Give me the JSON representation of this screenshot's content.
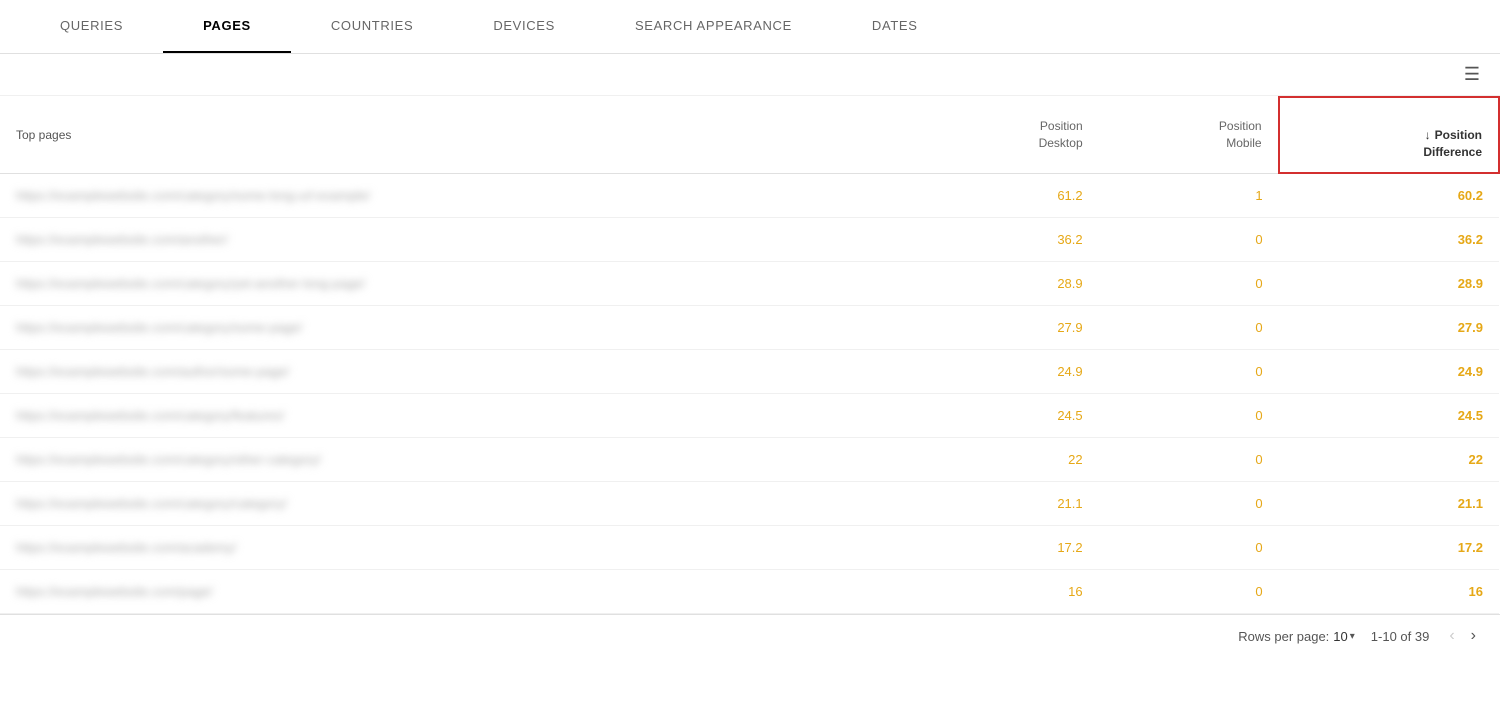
{
  "tabs": [
    {
      "id": "queries",
      "label": "QUERIES",
      "active": false
    },
    {
      "id": "pages",
      "label": "PAGES",
      "active": true
    },
    {
      "id": "countries",
      "label": "COUNTRIES",
      "active": false
    },
    {
      "id": "devices",
      "label": "DEVICES",
      "active": false
    },
    {
      "id": "search-appearance",
      "label": "SEARCH APPEARANCE",
      "active": false
    },
    {
      "id": "dates",
      "label": "DATES",
      "active": false
    }
  ],
  "table": {
    "col_pages_label": "Top pages",
    "col_desktop_label": "Position\nDesktop",
    "col_mobile_label": "Position\nMobile",
    "col_diff_label": "Position\nDifference",
    "rows": [
      {
        "page": "https://examplewebsite.com/category/some-long-url-example/",
        "desktop": "61.2",
        "mobile": "1",
        "diff": "60.2"
      },
      {
        "page": "https://examplewebsite.com/another/",
        "desktop": "36.2",
        "mobile": "0",
        "diff": "36.2"
      },
      {
        "page": "https://examplewebsite.com/category/yet-another-long-page/",
        "desktop": "28.9",
        "mobile": "0",
        "diff": "28.9"
      },
      {
        "page": "https://examplewebsite.com/category/some-page/",
        "desktop": "27.9",
        "mobile": "0",
        "diff": "27.9"
      },
      {
        "page": "https://examplewebsite.com/author/some-page/",
        "desktop": "24.9",
        "mobile": "0",
        "diff": "24.9"
      },
      {
        "page": "https://examplewebsite.com/category/features/",
        "desktop": "24.5",
        "mobile": "0",
        "diff": "24.5"
      },
      {
        "page": "https://examplewebsite.com/category/other-category/",
        "desktop": "22",
        "mobile": "0",
        "diff": "22"
      },
      {
        "page": "https://examplewebsite.com/category/category/",
        "desktop": "21.1",
        "mobile": "0",
        "diff": "21.1"
      },
      {
        "page": "https://examplewebsite.com/academy/",
        "desktop": "17.2",
        "mobile": "0",
        "diff": "17.2"
      },
      {
        "page": "https://examplewebsite.com/page/",
        "desktop": "16",
        "mobile": "0",
        "diff": "16"
      }
    ]
  },
  "footer": {
    "rows_per_page_label": "Rows per page:",
    "rows_per_page_value": "10",
    "pagination_info": "1-10 of 39"
  }
}
